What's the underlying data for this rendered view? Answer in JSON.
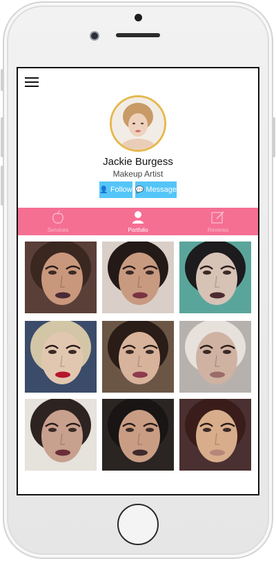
{
  "profile": {
    "name": "Jackie Burgess",
    "title": "Makeup Artist"
  },
  "actions": {
    "follow_label": "Follow",
    "message_label": "Message"
  },
  "tabs": [
    {
      "label": "Services",
      "icon": "apple-icon",
      "active": false
    },
    {
      "label": "Portfolio",
      "icon": "person-icon",
      "active": true
    },
    {
      "label": "Reviews",
      "icon": "edit-icon",
      "active": false
    }
  ],
  "colors": {
    "tab_bar": "#f56f93",
    "button": "#54c5f8",
    "avatar_ring": "#e5b84a"
  },
  "portfolio": {
    "photos": [
      {
        "skin": "#c9977c",
        "hair": "#3a2820",
        "bg": "#5a3f38",
        "lips": "#4a2a36"
      },
      {
        "skin": "#c89a80",
        "hair": "#231a18",
        "bg": "#d9cfc8",
        "lips": "#7a3342"
      },
      {
        "skin": "#d7c2b6",
        "hair": "#1d1b1e",
        "bg": "#5aa59b",
        "lips": "#4d2a30"
      },
      {
        "skin": "#e2c7b0",
        "hair": "#d2c6a6",
        "bg": "#3b4b6a",
        "lips": "#b4162a"
      },
      {
        "skin": "#d8b39b",
        "hair": "#2a1c16",
        "bg": "#6b5646",
        "lips": "#8e3b4d"
      },
      {
        "skin": "#cfb2a2",
        "hair": "#e7e1dc",
        "bg": "#b7b1ae",
        "lips": "#9a6d6a"
      },
      {
        "skin": "#c8a08e",
        "hair": "#2d2320",
        "bg": "#e6e2dc",
        "lips": "#6a2e38"
      },
      {
        "skin": "#c99d84",
        "hair": "#181514",
        "bg": "#2a2423",
        "lips": "#3e2a2c"
      },
      {
        "skin": "#d7ad8c",
        "hair": "#3a1d1a",
        "bg": "#4a3030",
        "lips": "#b8857a"
      }
    ]
  }
}
